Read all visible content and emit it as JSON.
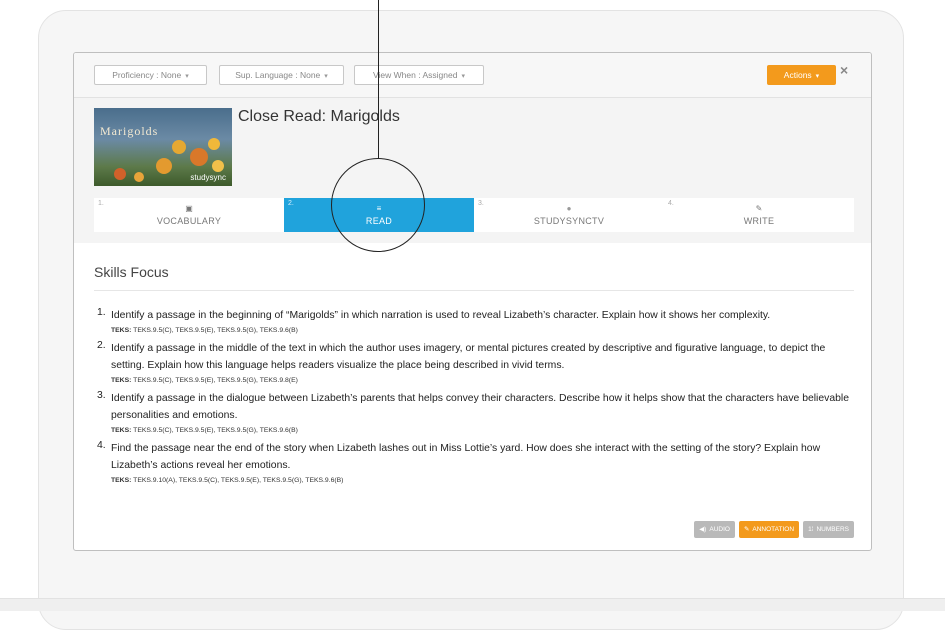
{
  "toolbar": {
    "proficiency": "Proficiency : None",
    "sup_language": "Sup. Language : None",
    "view_when": "View When : Assigned",
    "actions": "Actions",
    "close": "×"
  },
  "lesson": {
    "thumbnail_title": "Marigolds",
    "thumbnail_brand": "studysync",
    "title": "Close Read: Marigolds"
  },
  "tabs": [
    {
      "num": "1.",
      "icon": "briefcase-icon",
      "glyph": "▣",
      "label": "VOCABULARY",
      "active": false
    },
    {
      "num": "2.",
      "icon": "menu-icon",
      "glyph": "≡",
      "label": "READ",
      "active": true
    },
    {
      "num": "3.",
      "icon": "play-circle-icon",
      "glyph": "●",
      "label": "STUDYSYNCTV",
      "active": false
    },
    {
      "num": "4.",
      "icon": "pencil-icon",
      "glyph": "✎",
      "label": "WRITE",
      "active": false
    }
  ],
  "skills": {
    "title": "Skills Focus",
    "items": [
      {
        "num": "1.",
        "text": "Identify a passage in the beginning of “Marigolds” in which narration is used to reveal Lizabeth’s character. Explain how it shows her complexity.",
        "teks_label": "TEKS:",
        "teks": " TEKS.9.5(C), TEKS.9.5(E), TEKS.9.5(G), TEKS.9.6(B)"
      },
      {
        "num": "2.",
        "text": "Identify a passage in the middle of the text in which the author uses imagery, or mental pictures created by descriptive and figurative language, to depict the setting. Explain how this language helps readers visualize the place being described in vivid terms.",
        "teks_label": "TEKS:",
        "teks": " TEKS.9.5(C), TEKS.9.5(E), TEKS.9.5(G), TEKS.9.8(E)"
      },
      {
        "num": "3.",
        "text": "Identify a passage in the dialogue between Lizabeth’s parents that helps convey their characters. Describe how it helps show that the characters have believable personalities and emotions.",
        "teks_label": "TEKS:",
        "teks": " TEKS.9.5(C), TEKS.9.5(E), TEKS.9.5(G), TEKS.9.6(B)"
      },
      {
        "num": "4.",
        "text": "Find the passage near the end of the story when Lizabeth lashes out in Miss Lottie’s yard. How does she interact with the setting of the story? Explain how Lizabeth’s actions reveal her emotions.",
        "teks_label": "TEKS:",
        "teks": " TEKS.9.10(A), TEKS.9.5(C), TEKS.9.5(E), TEKS.9.5(G), TEKS.9.6(B)"
      }
    ]
  },
  "footer_buttons": {
    "audio": "AUDIO",
    "annotation": "ANNOTATION",
    "numbers": "NUMBERS"
  },
  "colors": {
    "accent_blue": "#20a3dc",
    "accent_orange": "#f39a1c"
  }
}
